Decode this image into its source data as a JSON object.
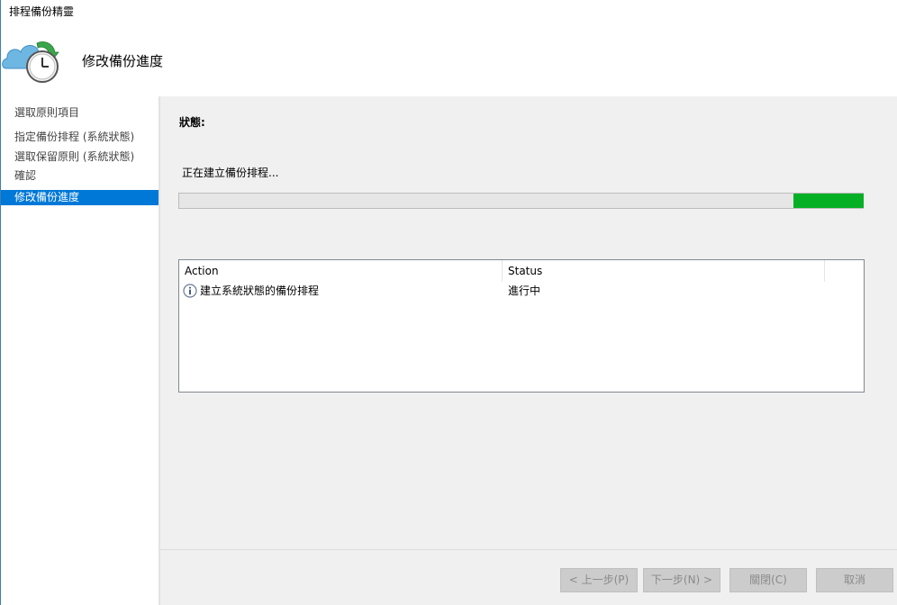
{
  "window": {
    "title": "排程備份精靈"
  },
  "header": {
    "title": "修改備份進度",
    "icon": "cloud-clock-icon"
  },
  "nav": {
    "items": [
      {
        "label": "選取原則項目",
        "active": false
      },
      {
        "label": "指定備份排程 (系統狀態)",
        "active": false
      },
      {
        "label": "選取保留原則 (系統狀態)",
        "active": false
      },
      {
        "label": "確認",
        "active": false
      },
      {
        "label": "修改備份進度",
        "active": true
      }
    ]
  },
  "main": {
    "status_label": "狀態:",
    "status_text": "正在建立備份排程...",
    "progress_color": "#06b025",
    "table": {
      "columns": [
        "Action",
        "Status"
      ],
      "rows": [
        {
          "icon": "info-icon",
          "action": "建立系統狀態的備份排程",
          "status": "進行中"
        }
      ]
    }
  },
  "footer": {
    "back_label": "< 上一步(P)",
    "next_label": "下一步(N) >",
    "close_label": "關閉(C)",
    "cancel_label": "取消"
  }
}
